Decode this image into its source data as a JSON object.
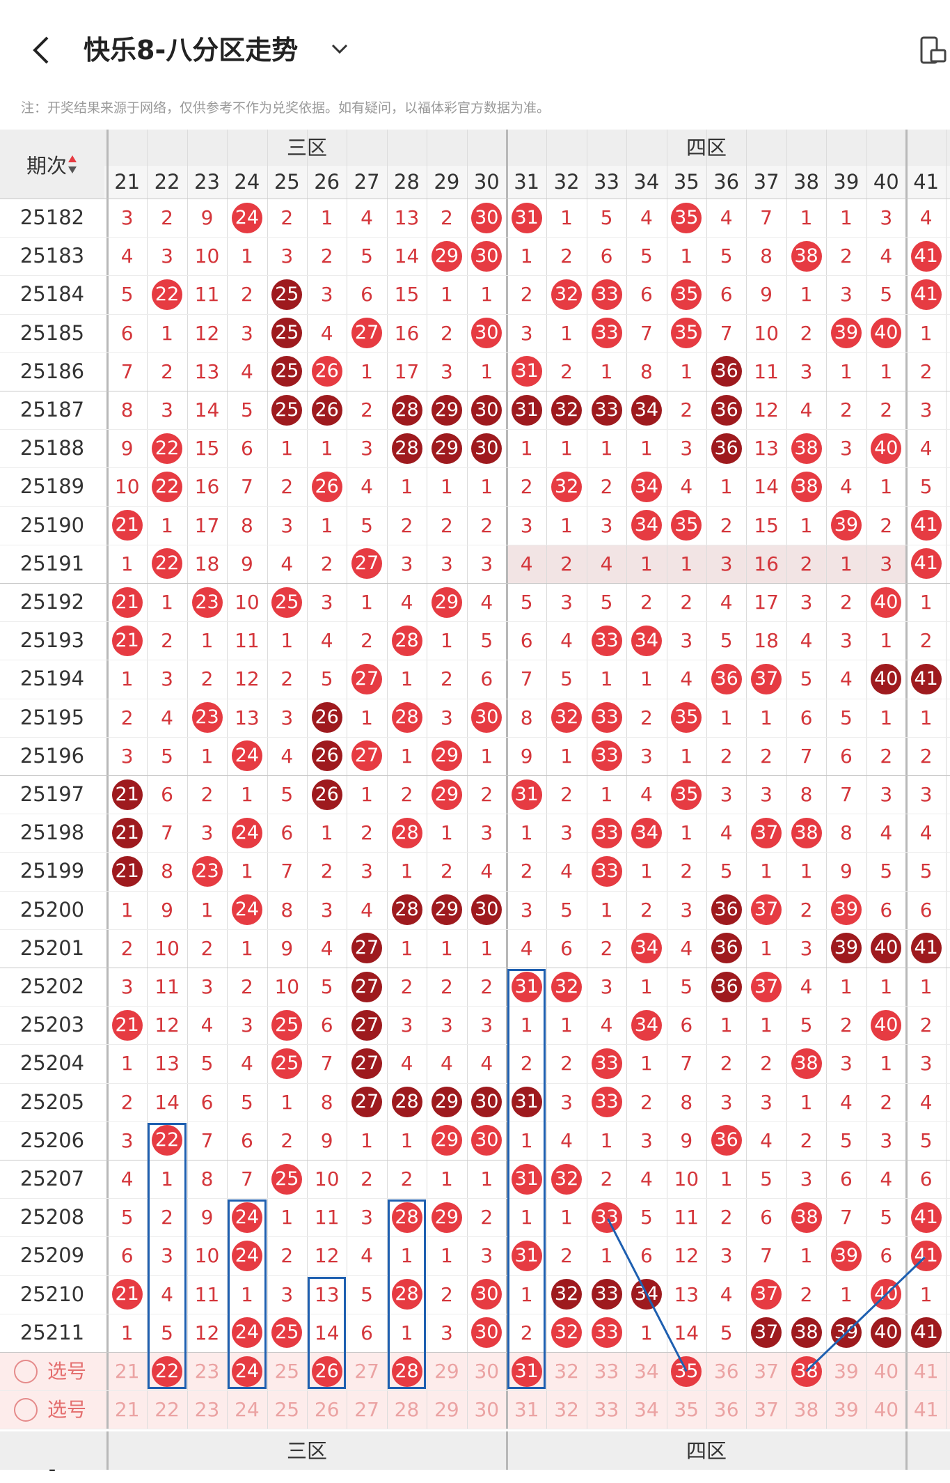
{
  "header": {
    "title": "快乐8-八分区走势",
    "back_icon": "chevron-left-icon",
    "dropdown_icon": "chevron-down-icon",
    "rotate_icon": "screen-rotate-icon"
  },
  "notice": "注：开奖结果来源于网络，仅供参考不作为兑奖依据。如有疑问，以福体彩官方数据为准。",
  "table": {
    "period_header": "期次",
    "sort_icon": "sort-arrows-icon",
    "section_3": "三区",
    "section_4": "四区",
    "columns": [
      "21",
      "22",
      "23",
      "24",
      "25",
      "26",
      "27",
      "28",
      "29",
      "30",
      "31",
      "32",
      "33",
      "34",
      "35",
      "36",
      "37",
      "38",
      "39",
      "40",
      "41"
    ],
    "rows": [
      {
        "period": "25182",
        "cells": [
          "3",
          "2",
          "9",
          "24",
          "2",
          "1",
          "4",
          "13",
          "2",
          "30",
          "31",
          "1",
          "5",
          "4",
          "35",
          "4",
          "7",
          "1",
          "1",
          "3",
          "4"
        ]
      },
      {
        "period": "25183",
        "cells": [
          "4",
          "3",
          "10",
          "1",
          "3",
          "2",
          "5",
          "14",
          "29",
          "30",
          "1",
          "2",
          "6",
          "5",
          "1",
          "5",
          "8",
          "38",
          "2",
          "4",
          "41"
        ]
      },
      {
        "period": "25184",
        "cells": [
          "5",
          "22",
          "11",
          "2",
          "25",
          "3",
          "6",
          "15",
          "1",
          "1",
          "2",
          "32",
          "33",
          "6",
          "35",
          "6",
          "9",
          "1",
          "3",
          "5",
          "41"
        ]
      },
      {
        "period": "25185",
        "cells": [
          "6",
          "1",
          "12",
          "3",
          "25",
          "4",
          "27",
          "16",
          "2",
          "30",
          "3",
          "1",
          "33",
          "7",
          "35",
          "7",
          "10",
          "2",
          "39",
          "40",
          "1"
        ]
      },
      {
        "period": "25186",
        "cells": [
          "7",
          "2",
          "13",
          "4",
          "25",
          "26",
          "1",
          "17",
          "3",
          "1",
          "31",
          "2",
          "1",
          "8",
          "1",
          "36",
          "11",
          "3",
          "1",
          "1",
          "2"
        ]
      },
      {
        "period": "25187",
        "cells": [
          "8",
          "3",
          "14",
          "5",
          "25",
          "26",
          "2",
          "28",
          "29",
          "30",
          "31",
          "32",
          "33",
          "34",
          "2",
          "36",
          "12",
          "4",
          "2",
          "2",
          "3"
        ]
      },
      {
        "period": "25188",
        "cells": [
          "9",
          "22",
          "15",
          "6",
          "1",
          "1",
          "3",
          "28",
          "29",
          "30",
          "1",
          "1",
          "1",
          "1",
          "3",
          "36",
          "13",
          "38",
          "3",
          "40",
          "4"
        ]
      },
      {
        "period": "25189",
        "cells": [
          "10",
          "22",
          "16",
          "7",
          "2",
          "26",
          "4",
          "1",
          "1",
          "1",
          "2",
          "32",
          "2",
          "34",
          "4",
          "1",
          "14",
          "38",
          "4",
          "1",
          "5"
        ]
      },
      {
        "period": "25190",
        "cells": [
          "21",
          "1",
          "17",
          "8",
          "3",
          "1",
          "5",
          "2",
          "2",
          "2",
          "3",
          "1",
          "3",
          "34",
          "35",
          "2",
          "15",
          "1",
          "39",
          "2",
          "41"
        ]
      },
      {
        "period": "25191",
        "cells": [
          "1",
          "22",
          "18",
          "9",
          "4",
          "2",
          "27",
          "3",
          "3",
          "3",
          "4",
          "2",
          "4",
          "1",
          "1",
          "3",
          "16",
          "2",
          "1",
          "3",
          "41"
        ]
      },
      {
        "period": "25192",
        "cells": [
          "21",
          "1",
          "23",
          "10",
          "25",
          "3",
          "1",
          "4",
          "29",
          "4",
          "5",
          "3",
          "5",
          "2",
          "2",
          "4",
          "17",
          "3",
          "2",
          "40",
          "1"
        ]
      },
      {
        "period": "25193",
        "cells": [
          "21",
          "2",
          "1",
          "11",
          "1",
          "4",
          "2",
          "28",
          "1",
          "5",
          "6",
          "4",
          "33",
          "34",
          "3",
          "5",
          "18",
          "4",
          "3",
          "1",
          "2"
        ]
      },
      {
        "period": "25194",
        "cells": [
          "1",
          "3",
          "2",
          "12",
          "2",
          "5",
          "27",
          "1",
          "2",
          "6",
          "7",
          "5",
          "1",
          "1",
          "4",
          "36",
          "37",
          "5",
          "4",
          "40",
          "41"
        ]
      },
      {
        "period": "25195",
        "cells": [
          "2",
          "4",
          "23",
          "13",
          "3",
          "26",
          "1",
          "28",
          "3",
          "30",
          "8",
          "32",
          "33",
          "2",
          "35",
          "1",
          "1",
          "6",
          "5",
          "1",
          "1"
        ]
      },
      {
        "period": "25196",
        "cells": [
          "3",
          "5",
          "1",
          "24",
          "4",
          "26",
          "27",
          "1",
          "29",
          "1",
          "9",
          "1",
          "33",
          "3",
          "1",
          "2",
          "2",
          "7",
          "6",
          "2",
          "2"
        ]
      },
      {
        "period": "25197",
        "cells": [
          "21",
          "6",
          "2",
          "1",
          "5",
          "26",
          "1",
          "2",
          "29",
          "2",
          "31",
          "2",
          "1",
          "4",
          "35",
          "3",
          "3",
          "8",
          "7",
          "3",
          "3"
        ]
      },
      {
        "period": "25198",
        "cells": [
          "21",
          "7",
          "3",
          "24",
          "6",
          "1",
          "2",
          "28",
          "1",
          "3",
          "1",
          "3",
          "33",
          "34",
          "1",
          "4",
          "37",
          "38",
          "8",
          "4",
          "4"
        ]
      },
      {
        "period": "25199",
        "cells": [
          "21",
          "8",
          "23",
          "1",
          "7",
          "2",
          "3",
          "1",
          "2",
          "4",
          "2",
          "4",
          "33",
          "1",
          "2",
          "5",
          "1",
          "1",
          "9",
          "5",
          "5"
        ]
      },
      {
        "period": "25200",
        "cells": [
          "1",
          "9",
          "1",
          "24",
          "8",
          "3",
          "4",
          "28",
          "29",
          "30",
          "3",
          "5",
          "1",
          "2",
          "3",
          "36",
          "37",
          "2",
          "39",
          "6",
          "6"
        ]
      },
      {
        "period": "25201",
        "cells": [
          "2",
          "10",
          "2",
          "1",
          "9",
          "4",
          "27",
          "1",
          "1",
          "1",
          "4",
          "6",
          "2",
          "34",
          "4",
          "36",
          "1",
          "3",
          "39",
          "40",
          "41"
        ]
      },
      {
        "period": "25202",
        "cells": [
          "3",
          "11",
          "3",
          "2",
          "10",
          "5",
          "27",
          "2",
          "2",
          "2",
          "31",
          "32",
          "3",
          "1",
          "5",
          "36",
          "37",
          "4",
          "1",
          "1",
          "1"
        ]
      },
      {
        "period": "25203",
        "cells": [
          "21",
          "12",
          "4",
          "3",
          "25",
          "6",
          "27",
          "3",
          "3",
          "3",
          "1",
          "1",
          "4",
          "34",
          "6",
          "1",
          "1",
          "5",
          "2",
          "40",
          "2"
        ]
      },
      {
        "period": "25204",
        "cells": [
          "1",
          "13",
          "5",
          "4",
          "25",
          "7",
          "27",
          "4",
          "4",
          "4",
          "2",
          "2",
          "33",
          "1",
          "7",
          "2",
          "2",
          "38",
          "3",
          "1",
          "3"
        ]
      },
      {
        "period": "25205",
        "cells": [
          "2",
          "14",
          "6",
          "5",
          "1",
          "8",
          "27",
          "28",
          "29",
          "30",
          "31",
          "3",
          "33",
          "2",
          "8",
          "3",
          "3",
          "1",
          "4",
          "2",
          "4"
        ]
      },
      {
        "period": "25206",
        "cells": [
          "3",
          "22",
          "7",
          "6",
          "2",
          "9",
          "1",
          "1",
          "29",
          "30",
          "1",
          "4",
          "1",
          "3",
          "9",
          "36",
          "4",
          "2",
          "5",
          "3",
          "5"
        ]
      },
      {
        "period": "25207",
        "cells": [
          "4",
          "1",
          "8",
          "7",
          "25",
          "10",
          "2",
          "2",
          "1",
          "1",
          "31",
          "32",
          "2",
          "4",
          "10",
          "1",
          "5",
          "3",
          "6",
          "4",
          "6"
        ]
      },
      {
        "period": "25208",
        "cells": [
          "5",
          "2",
          "9",
          "24",
          "1",
          "11",
          "3",
          "28",
          "29",
          "2",
          "1",
          "1",
          "33",
          "5",
          "11",
          "2",
          "6",
          "38",
          "7",
          "5",
          "41"
        ]
      },
      {
        "period": "25209",
        "cells": [
          "6",
          "3",
          "10",
          "24",
          "2",
          "12",
          "4",
          "1",
          "1",
          "3",
          "31",
          "2",
          "1",
          "6",
          "12",
          "3",
          "7",
          "1",
          "39",
          "6",
          "41"
        ]
      },
      {
        "period": "25210",
        "cells": [
          "21",
          "4",
          "11",
          "1",
          "3",
          "13",
          "5",
          "28",
          "2",
          "30",
          "1",
          "32",
          "33",
          "34",
          "13",
          "4",
          "37",
          "2",
          "1",
          "40",
          "1"
        ]
      },
      {
        "period": "25211",
        "cells": [
          "1",
          "5",
          "12",
          "24",
          "25",
          "14",
          "6",
          "1",
          "3",
          "30",
          "2",
          "32",
          "33",
          "1",
          "14",
          "5",
          "37",
          "38",
          "39",
          "40",
          "41"
        ]
      }
    ],
    "pick_rows": [
      {
        "label": "选号",
        "radio_icon": "radio-empty-icon",
        "selected": [
          "22",
          "24",
          "26",
          "28",
          "31",
          "35",
          "38"
        ]
      },
      {
        "label": "选号",
        "radio_icon": "radio-empty-icon",
        "selected": []
      }
    ],
    "dark_balls": {
      "25184": [
        "25"
      ],
      "25185": [
        "25"
      ],
      "25186": [
        "25",
        "36"
      ],
      "25187": [
        "25",
        "26",
        "28",
        "29",
        "30",
        "31",
        "32",
        "33",
        "34",
        "36"
      ],
      "25188": [
        "28",
        "29",
        "30",
        "36"
      ],
      "25194": [
        "40",
        "41"
      ],
      "25195": [
        "26"
      ],
      "25196": [
        "26"
      ],
      "25197": [
        "21",
        "26"
      ],
      "25198": [
        "21"
      ],
      "25199": [
        "21"
      ],
      "25200": [
        "28",
        "29",
        "30",
        "36"
      ],
      "25201": [
        "27",
        "36",
        "39",
        "40",
        "41"
      ],
      "25202": [
        "27",
        "36"
      ],
      "25203": [
        "27"
      ],
      "25204": [
        "27"
      ],
      "25205": [
        "27",
        "28",
        "29",
        "30",
        "31"
      ],
      "25210": [
        "32",
        "33",
        "34"
      ],
      "25211": [
        "37",
        "38",
        "39",
        "40",
        "41"
      ]
    },
    "footer_period_placeholder": "-"
  },
  "colors": {
    "ball_light": "#e63b42",
    "ball_dark": "#9e1a1e",
    "number_text": "#d4363b",
    "header_bg": "#eeeeee",
    "highlight_row": "#f2e4e4",
    "pick_row_bg": "#fdeceb",
    "selection_box": "#1e5fb0"
  }
}
